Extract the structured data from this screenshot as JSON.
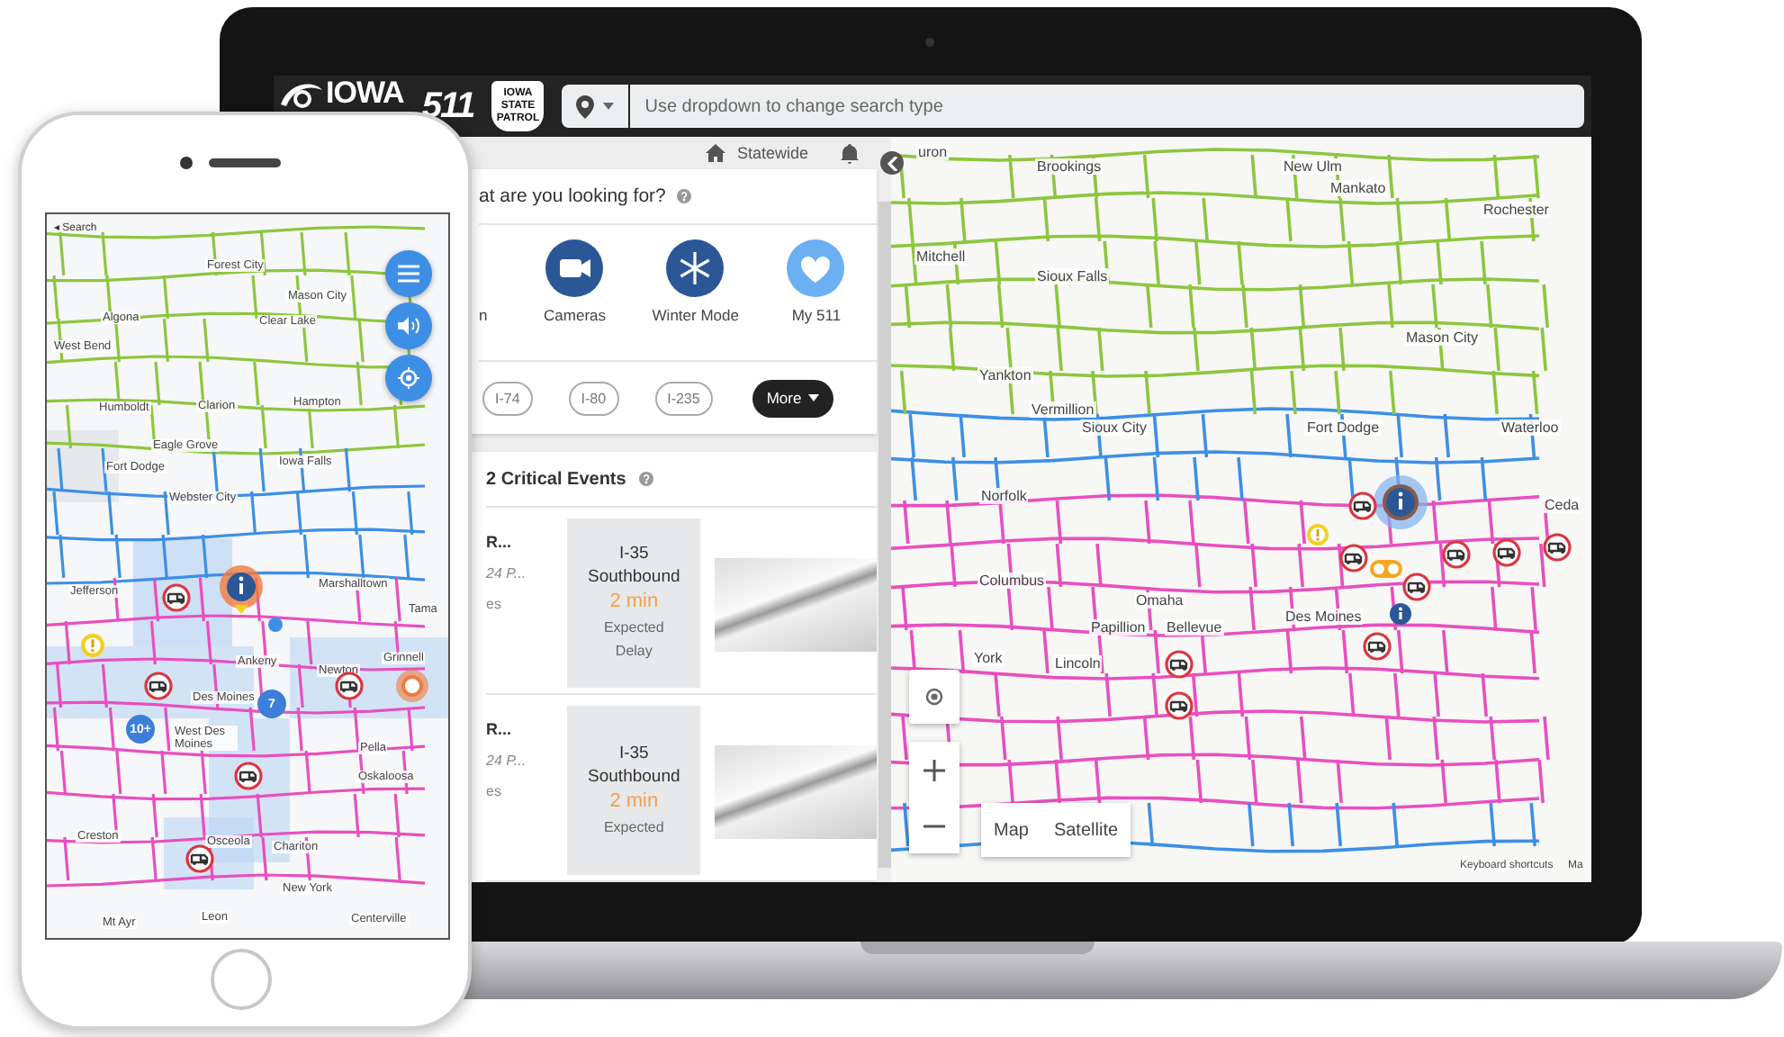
{
  "header": {
    "logo": "IOWA",
    "brand": "511",
    "patrol_badge": "IOWA STATE PATROL",
    "search": {
      "placeholder": "Use dropdown to change search type"
    }
  },
  "panel": {
    "location": "Statewide",
    "question": "at are you looking for?",
    "categories": [
      {
        "label": "n",
        "kind": "partial"
      },
      {
        "label": "Cameras",
        "kind": "camera"
      },
      {
        "label": "Winter Mode",
        "kind": "snow"
      },
      {
        "label": "My 511",
        "kind": "heart"
      }
    ],
    "routes": [
      "I-74",
      "I-80",
      "I-235"
    ],
    "more": "More",
    "events_title": "2 Critical Events",
    "events": [
      {
        "title": "R...",
        "time": "24 P...",
        "note": "es",
        "road": "I-35",
        "direction": "Southbound",
        "delay": "2 min",
        "caption": "Expected Delay"
      },
      {
        "title": "R...",
        "time": "24 P...",
        "note": "es",
        "road": "I-35",
        "direction": "Southbound",
        "delay": "2 min",
        "caption": "Expected"
      }
    ]
  },
  "map": {
    "labels": [
      "uron",
      "Brookings",
      "New Ulm",
      "Mankato",
      "Rochester",
      "Mitchell",
      "Sioux Falls",
      "Mason City",
      "Yankton",
      "Vermillion",
      "Sioux City",
      "Fort Dodge",
      "Waterloo",
      "Norfolk",
      "Columbus",
      "Omaha",
      "Papillion",
      "Bellevue",
      "York",
      "Lincoln",
      "Des Moines",
      "Ceda"
    ],
    "map_types": [
      "Map",
      "Satellite"
    ],
    "attribution": "Keyboard shortcuts",
    "attribution_cut": "Ma"
  },
  "phone": {
    "back": "◂ Search",
    "labels": [
      "Forest City",
      "Mason City",
      "Algona",
      "Clear Lake",
      "West Bend",
      "Humboldt",
      "Clarion",
      "Hampton",
      "Eagle Grove",
      "Fort Dodge",
      "Iowa Falls",
      "Webster City",
      "Jefferson",
      "Marshalltown",
      "Tama",
      "Ankeny",
      "Newton",
      "Grinnell",
      "Des Moines",
      "West Des Moines",
      "Pella",
      "Oskaloosa",
      "Creston",
      "Osceola",
      "Chariton",
      "New York",
      "Mt Ayr",
      "Leon",
      "Centerville"
    ],
    "clusters": [
      "7",
      "10+"
    ]
  }
}
